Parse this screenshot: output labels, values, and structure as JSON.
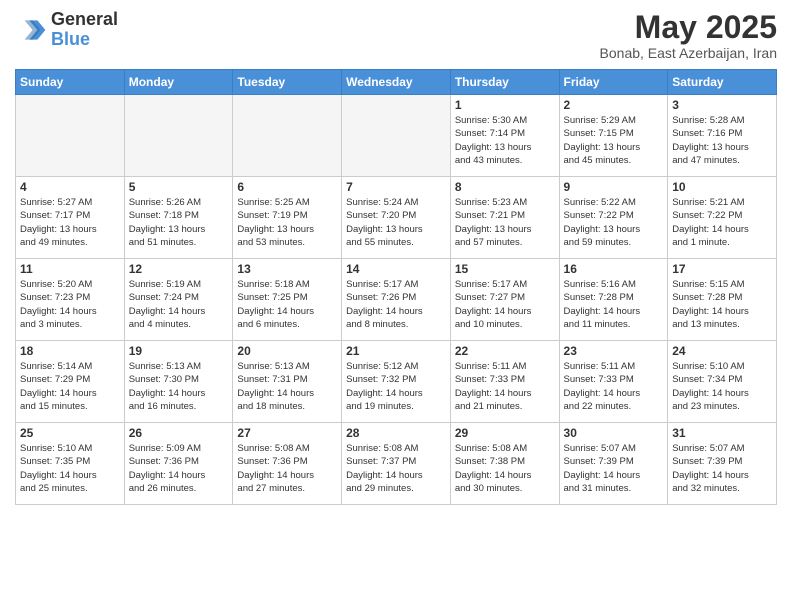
{
  "logo": {
    "general": "General",
    "blue": "Blue"
  },
  "title": {
    "month": "May 2025",
    "location": "Bonab, East Azerbaijan, Iran"
  },
  "weekdays": [
    "Sunday",
    "Monday",
    "Tuesday",
    "Wednesday",
    "Thursday",
    "Friday",
    "Saturday"
  ],
  "weeks": [
    [
      {
        "day": "",
        "info": ""
      },
      {
        "day": "",
        "info": ""
      },
      {
        "day": "",
        "info": ""
      },
      {
        "day": "",
        "info": ""
      },
      {
        "day": "1",
        "info": "Sunrise: 5:30 AM\nSunset: 7:14 PM\nDaylight: 13 hours\nand 43 minutes."
      },
      {
        "day": "2",
        "info": "Sunrise: 5:29 AM\nSunset: 7:15 PM\nDaylight: 13 hours\nand 45 minutes."
      },
      {
        "day": "3",
        "info": "Sunrise: 5:28 AM\nSunset: 7:16 PM\nDaylight: 13 hours\nand 47 minutes."
      }
    ],
    [
      {
        "day": "4",
        "info": "Sunrise: 5:27 AM\nSunset: 7:17 PM\nDaylight: 13 hours\nand 49 minutes."
      },
      {
        "day": "5",
        "info": "Sunrise: 5:26 AM\nSunset: 7:18 PM\nDaylight: 13 hours\nand 51 minutes."
      },
      {
        "day": "6",
        "info": "Sunrise: 5:25 AM\nSunset: 7:19 PM\nDaylight: 13 hours\nand 53 minutes."
      },
      {
        "day": "7",
        "info": "Sunrise: 5:24 AM\nSunset: 7:20 PM\nDaylight: 13 hours\nand 55 minutes."
      },
      {
        "day": "8",
        "info": "Sunrise: 5:23 AM\nSunset: 7:21 PM\nDaylight: 13 hours\nand 57 minutes."
      },
      {
        "day": "9",
        "info": "Sunrise: 5:22 AM\nSunset: 7:22 PM\nDaylight: 13 hours\nand 59 minutes."
      },
      {
        "day": "10",
        "info": "Sunrise: 5:21 AM\nSunset: 7:22 PM\nDaylight: 14 hours\nand 1 minute."
      }
    ],
    [
      {
        "day": "11",
        "info": "Sunrise: 5:20 AM\nSunset: 7:23 PM\nDaylight: 14 hours\nand 3 minutes."
      },
      {
        "day": "12",
        "info": "Sunrise: 5:19 AM\nSunset: 7:24 PM\nDaylight: 14 hours\nand 4 minutes."
      },
      {
        "day": "13",
        "info": "Sunrise: 5:18 AM\nSunset: 7:25 PM\nDaylight: 14 hours\nand 6 minutes."
      },
      {
        "day": "14",
        "info": "Sunrise: 5:17 AM\nSunset: 7:26 PM\nDaylight: 14 hours\nand 8 minutes."
      },
      {
        "day": "15",
        "info": "Sunrise: 5:17 AM\nSunset: 7:27 PM\nDaylight: 14 hours\nand 10 minutes."
      },
      {
        "day": "16",
        "info": "Sunrise: 5:16 AM\nSunset: 7:28 PM\nDaylight: 14 hours\nand 11 minutes."
      },
      {
        "day": "17",
        "info": "Sunrise: 5:15 AM\nSunset: 7:28 PM\nDaylight: 14 hours\nand 13 minutes."
      }
    ],
    [
      {
        "day": "18",
        "info": "Sunrise: 5:14 AM\nSunset: 7:29 PM\nDaylight: 14 hours\nand 15 minutes."
      },
      {
        "day": "19",
        "info": "Sunrise: 5:13 AM\nSunset: 7:30 PM\nDaylight: 14 hours\nand 16 minutes."
      },
      {
        "day": "20",
        "info": "Sunrise: 5:13 AM\nSunset: 7:31 PM\nDaylight: 14 hours\nand 18 minutes."
      },
      {
        "day": "21",
        "info": "Sunrise: 5:12 AM\nSunset: 7:32 PM\nDaylight: 14 hours\nand 19 minutes."
      },
      {
        "day": "22",
        "info": "Sunrise: 5:11 AM\nSunset: 7:33 PM\nDaylight: 14 hours\nand 21 minutes."
      },
      {
        "day": "23",
        "info": "Sunrise: 5:11 AM\nSunset: 7:33 PM\nDaylight: 14 hours\nand 22 minutes."
      },
      {
        "day": "24",
        "info": "Sunrise: 5:10 AM\nSunset: 7:34 PM\nDaylight: 14 hours\nand 23 minutes."
      }
    ],
    [
      {
        "day": "25",
        "info": "Sunrise: 5:10 AM\nSunset: 7:35 PM\nDaylight: 14 hours\nand 25 minutes."
      },
      {
        "day": "26",
        "info": "Sunrise: 5:09 AM\nSunset: 7:36 PM\nDaylight: 14 hours\nand 26 minutes."
      },
      {
        "day": "27",
        "info": "Sunrise: 5:08 AM\nSunset: 7:36 PM\nDaylight: 14 hours\nand 27 minutes."
      },
      {
        "day": "28",
        "info": "Sunrise: 5:08 AM\nSunset: 7:37 PM\nDaylight: 14 hours\nand 29 minutes."
      },
      {
        "day": "29",
        "info": "Sunrise: 5:08 AM\nSunset: 7:38 PM\nDaylight: 14 hours\nand 30 minutes."
      },
      {
        "day": "30",
        "info": "Sunrise: 5:07 AM\nSunset: 7:39 PM\nDaylight: 14 hours\nand 31 minutes."
      },
      {
        "day": "31",
        "info": "Sunrise: 5:07 AM\nSunset: 7:39 PM\nDaylight: 14 hours\nand 32 minutes."
      }
    ]
  ]
}
